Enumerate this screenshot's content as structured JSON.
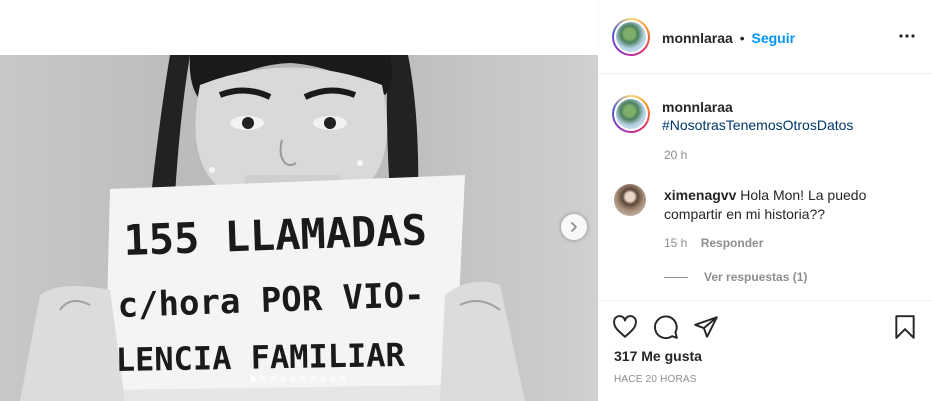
{
  "post": {
    "author": "monnlaraa",
    "separator": "•",
    "follow_label": "Seguir",
    "sign_text": {
      "line1": "155 LLAMADAS",
      "line2": "c/hora POR VIO-",
      "line3": "LENCIA FAMILIAR"
    },
    "carousel": {
      "dot_count": 10,
      "active_index": 0
    }
  },
  "caption": {
    "username": "monnlaraa",
    "hashtag": "#NosotrasTenemosOtrosDatos",
    "time": "20 h"
  },
  "comments": [
    {
      "username": "ximenagvv",
      "text": "Hola Mon! La puedo compartir en mi historia??",
      "time": "15 h",
      "reply_label": "Responder",
      "view_replies": "Ver respuestas (1)"
    }
  ],
  "actions": {
    "likes": "317 Me gusta",
    "posted_ago": "HACE 20 HORAS"
  },
  "icons": [
    "more-options-icon",
    "chevron-right-icon",
    "heart-icon",
    "comment-icon",
    "share-icon",
    "bookmark-icon"
  ]
}
